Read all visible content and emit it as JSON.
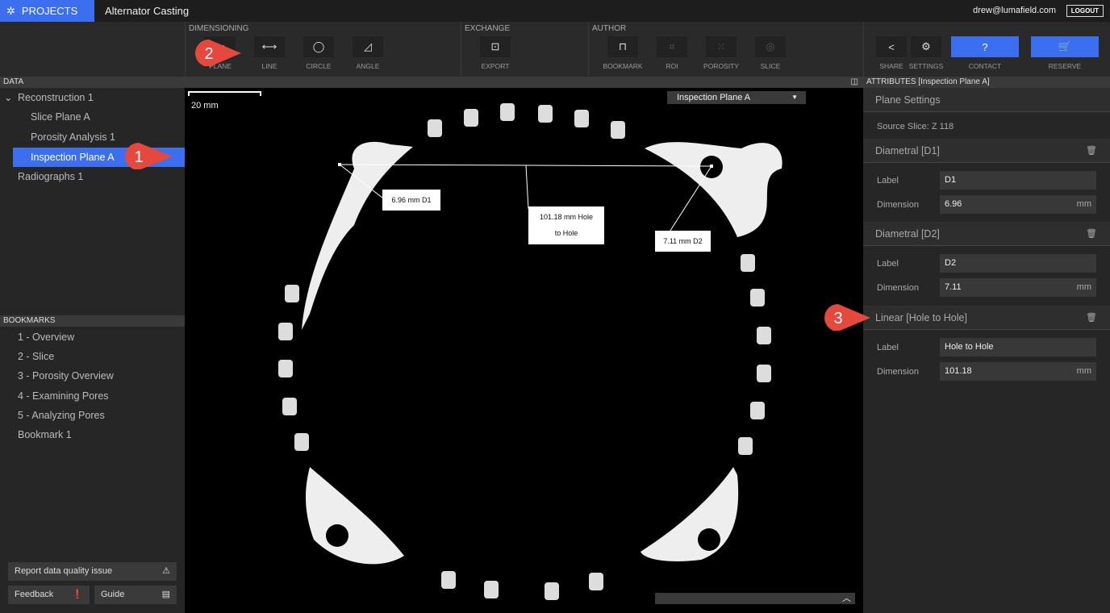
{
  "topbar": {
    "projects": "PROJECTS",
    "title": "Alternator Casting",
    "email": "drew@lumafield.com",
    "logout": "LOGOUT"
  },
  "toolbar": {
    "groups": [
      {
        "label": "DIMENSIONING"
      },
      {
        "label": "EXCHANGE"
      },
      {
        "label": "AUTHOR"
      }
    ],
    "dimensioning": [
      {
        "label": "PLANE",
        "icon": "plane-icon"
      },
      {
        "label": "LINE",
        "icon": "line-icon"
      },
      {
        "label": "CIRCLE",
        "icon": "circle-icon"
      },
      {
        "label": "ANGLE",
        "icon": "angle-icon"
      }
    ],
    "exchange": [
      {
        "label": "EXPORT",
        "icon": "export-icon"
      }
    ],
    "author": [
      {
        "label": "BOOKMARK",
        "icon": "bookmark-icon"
      },
      {
        "label": "ROI",
        "icon": "crop-icon"
      },
      {
        "label": "POROSITY",
        "icon": "porosity-icon"
      },
      {
        "label": "SLICE",
        "icon": "slice-icon"
      }
    ],
    "actions": [
      {
        "label": "SHARE",
        "icon": "share-icon"
      },
      {
        "label": "SETTINGS",
        "icon": "gear-icon"
      },
      {
        "label": "CONTACT",
        "icon": "help-icon"
      },
      {
        "label": "RESERVE",
        "icon": "cart-icon"
      }
    ]
  },
  "data_panel": {
    "header": "DATA",
    "items": [
      {
        "label": "Reconstruction 1"
      },
      {
        "label": "Slice Plane A"
      },
      {
        "label": "Porosity Analysis 1"
      },
      {
        "label": "Inspection Plane A",
        "selected": true
      },
      {
        "label": "Radiographs 1"
      }
    ]
  },
  "bookmarks": {
    "header": "BOOKMARKS",
    "items": [
      {
        "label": "1 - Overview"
      },
      {
        "label": "2 - Slice"
      },
      {
        "label": "3 - Porosity Overview"
      },
      {
        "label": "4 - Examining Pores"
      },
      {
        "label": "5 - Analyzing Pores"
      },
      {
        "label": "Bookmark 1"
      }
    ]
  },
  "footer": {
    "report": "Report data quality issue",
    "feedback": "Feedback",
    "guide": "Guide"
  },
  "viewer": {
    "scale": "20 mm",
    "plane_select": "Inspection Plane A",
    "measurements": {
      "d1": "6.96 mm D1",
      "d2": "7.11 mm D2",
      "linear_1": "101.18 mm Hole",
      "linear_2": "to Hole"
    }
  },
  "attributes": {
    "header": "ATTRIBUTES [Inspection Plane A]",
    "plane_settings": "Plane Settings",
    "source_slice": "Source Slice: Z 118",
    "sections": [
      {
        "title": "Diametral [D1]",
        "label_caption": "Label",
        "label": "D1",
        "dimension_caption": "Dimension",
        "dimension": "6.96",
        "unit": "mm"
      },
      {
        "title": "Diametral [D2]",
        "label_caption": "Label",
        "label": "D2",
        "dimension_caption": "Dimension",
        "dimension": "7.11",
        "unit": "mm"
      },
      {
        "title": "Linear [Hole to Hole]",
        "label_caption": "Label",
        "label": "Hole to Hole",
        "dimension_caption": "Dimension",
        "dimension": "101.18",
        "unit": "mm"
      }
    ]
  },
  "callouts": [
    "1",
    "2",
    "3"
  ],
  "colors": {
    "accent": "#3c6ef0",
    "callout": "#e5483c"
  }
}
